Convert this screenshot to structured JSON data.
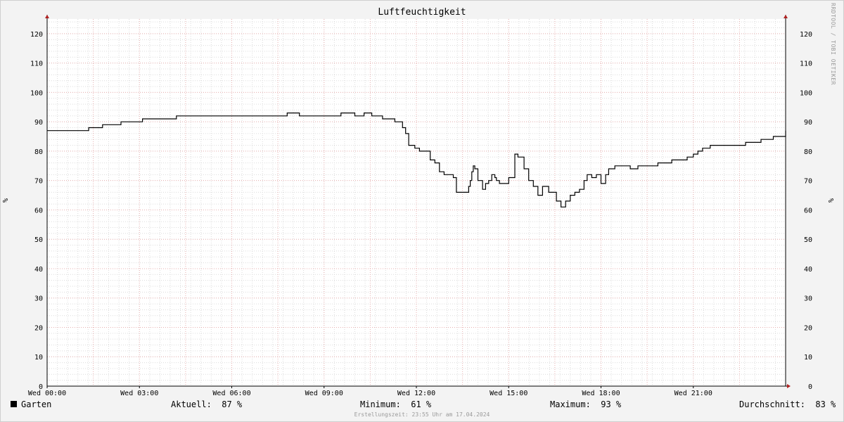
{
  "chart_data": {
    "type": "line",
    "title": "Luftfeuchtigkeit",
    "ylabel": "%",
    "ylim": [
      0,
      125
    ],
    "grid": true,
    "watermark": "RRDTOOL / TOBI OETIKER",
    "y_ticks": [
      0,
      10,
      20,
      30,
      40,
      50,
      60,
      70,
      80,
      90,
      100,
      110,
      120
    ],
    "x_range_hours": [
      0,
      24
    ],
    "x_ticks": [
      {
        "hour": 0,
        "label": "Wed 00:00"
      },
      {
        "hour": 3,
        "label": "Wed 03:00"
      },
      {
        "hour": 6,
        "label": "Wed 06:00"
      },
      {
        "hour": 9,
        "label": "Wed 09:00"
      },
      {
        "hour": 12,
        "label": "Wed 12:00"
      },
      {
        "hour": 15,
        "label": "Wed 15:00"
      },
      {
        "hour": 18,
        "label": "Wed 18:00"
      },
      {
        "hour": 21,
        "label": "Wed 21:00"
      }
    ],
    "series": [
      {
        "name": "Garten",
        "color": "#000000",
        "x_hours": [
          0,
          1.0,
          1.35,
          1.8,
          2.4,
          3.1,
          4.2,
          7.8,
          8.2,
          9.2,
          9.55,
          10.0,
          10.15,
          10.3,
          10.55,
          10.9,
          11.3,
          11.55,
          11.65,
          11.75,
          11.85,
          11.95,
          12.1,
          12.45,
          12.6,
          12.75,
          12.9,
          13.05,
          13.2,
          13.3,
          13.7,
          13.75,
          13.8,
          13.85,
          13.9,
          14.0,
          14.15,
          14.25,
          14.35,
          14.45,
          14.55,
          14.6,
          14.7,
          14.85,
          15.0,
          15.2,
          15.3,
          15.5,
          15.65,
          15.8,
          15.95,
          16.1,
          16.3,
          16.4,
          16.55,
          16.7,
          16.85,
          17.0,
          17.15,
          17.3,
          17.45,
          17.55,
          17.7,
          17.85,
          18.0,
          18.15,
          18.25,
          18.45,
          18.65,
          18.95,
          19.2,
          19.5,
          19.85,
          20.3,
          20.65,
          20.8,
          21.0,
          21.15,
          21.3,
          21.55,
          21.95,
          22.7,
          23.2,
          23.6,
          24.0
        ],
        "values": [
          87,
          87,
          88,
          89,
          90,
          91,
          92,
          93,
          92,
          92,
          93,
          92,
          92,
          93,
          92,
          91,
          90,
          88,
          86,
          82,
          82,
          81,
          80,
          77,
          76,
          73,
          72,
          72,
          71,
          66,
          68,
          70,
          73,
          75,
          74,
          70,
          67,
          69,
          70,
          72,
          71,
          70,
          69,
          69,
          71,
          79,
          78,
          74,
          70,
          68,
          65,
          68,
          66,
          66,
          63,
          61,
          63,
          65,
          66,
          67,
          70,
          72,
          71,
          72,
          69,
          72,
          74,
          75,
          75,
          74,
          75,
          75,
          76,
          77,
          77,
          78,
          79,
          80,
          81,
          82,
          82,
          83,
          84,
          85,
          87
        ]
      }
    ]
  },
  "legend": {
    "series_name": "Garten",
    "aktuell": "Aktuell:  87 %",
    "minimum": "Minimum:  61 %",
    "maximum": "Maximum:  93 %",
    "durchschnitt": "Durchschnitt:  83 %"
  },
  "footer": "Erstellungszeit: 23:55 Uhr am 17.04.2024",
  "colors": {
    "background": "#f3f3f3",
    "plot_area": "#ffffff",
    "minor_grid": "#dcdcdc",
    "major_grid": "#e8b0b0",
    "axis_arrow": "#b02020"
  }
}
